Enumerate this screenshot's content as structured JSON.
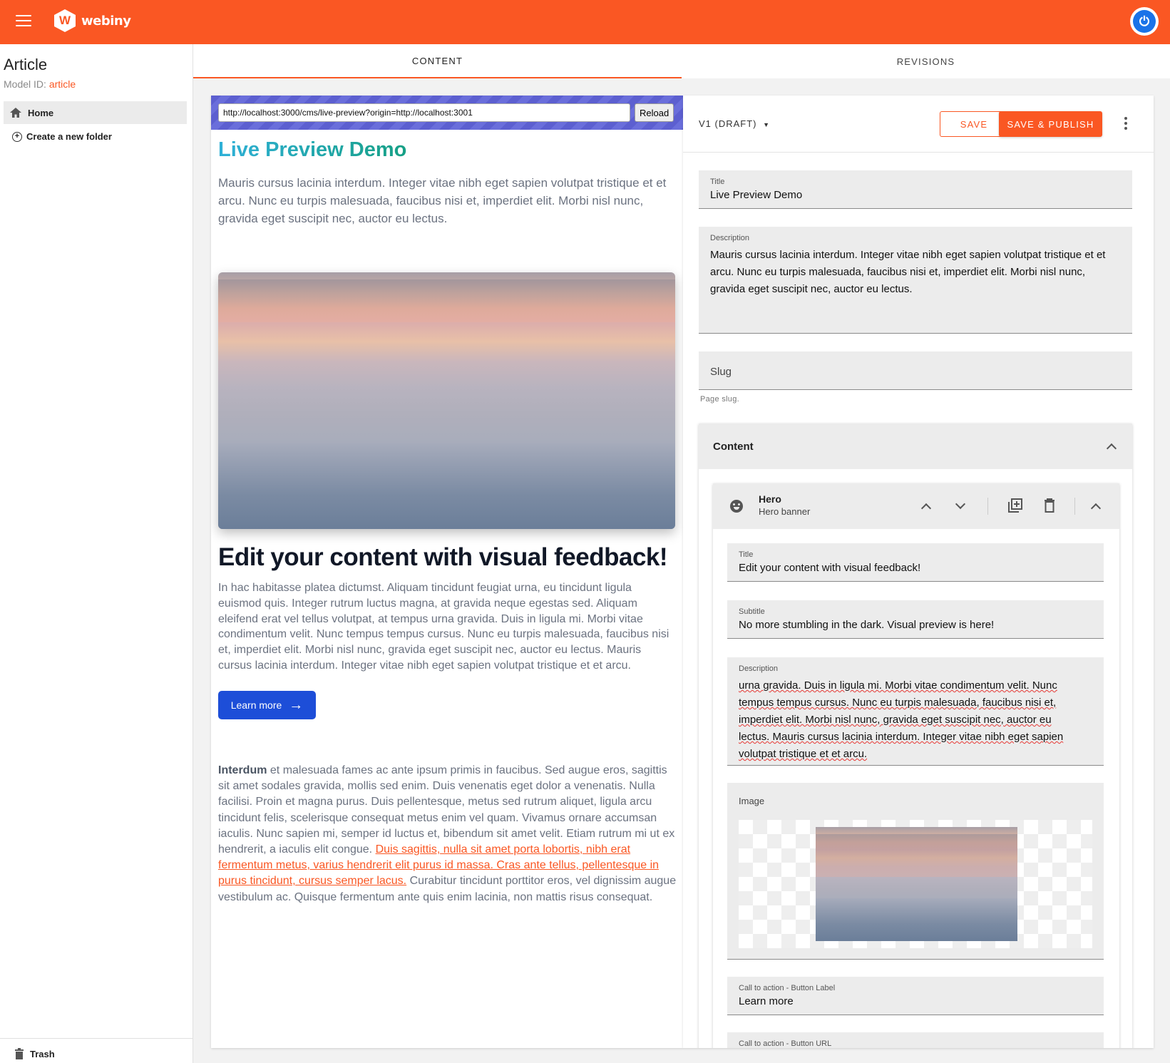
{
  "topbar": {
    "brand": "webiny",
    "logo_letter": "W",
    "accent": "#fa5723"
  },
  "sidebar": {
    "title": "Article",
    "model_label": "Model ID:",
    "model_id": "article",
    "home_label": "Home",
    "new_folder_label": "Create a new folder",
    "trash_label": "Trash"
  },
  "tabs": [
    {
      "label": "CONTENT",
      "active": true
    },
    {
      "label": "REVISIONS",
      "active": false
    }
  ],
  "preview": {
    "url": "http://localhost:3000/cms/live-preview?origin=http://localhost:3001",
    "reload_label": "Reload",
    "title": "Live Preview Demo",
    "description": "Mauris cursus lacinia interdum. Integer vitae nibh eget sapien volutpat tristique et et arcu. Nunc eu turpis malesuada, faucibus nisi et, imperdiet elit. Morbi nisl nunc, gravida eget suscipit nec, auctor eu lectus.",
    "hero_heading": "Edit your content with visual feedback!",
    "hero_paragraph": "In hac habitasse platea dictumst. Aliquam tincidunt feugiat urna, eu tincidunt ligula euismod quis. Integer rutrum luctus magna, at gravida neque egestas sed. Aliquam eleifend erat vel tellus volutpat, at tempus urna gravida. Duis in ligula mi. Morbi vitae condimentum velit. Nunc tempus tempus cursus. Nunc eu turpis malesuada, faucibus nisi et, imperdiet elit. Morbi nisl nunc, gravida eget suscipit nec, auctor eu lectus. Mauris cursus lacinia interdum. Integer vitae nibh eget sapien volutpat tristique et et arcu.",
    "cta_label": "Learn more",
    "body_bold": "Interdum",
    "body_text": " et malesuada fames ac ante ipsum primis in faucibus. Sed augue eros, sagittis sit amet sodales gravida, mollis sed enim. Duis venenatis eget dolor a venenatis. Nulla facilisi. Proin et magna purus. Duis pellentesque, metus sed rutrum aliquet, ligula arcu tincidunt felis, scelerisque consequat metus enim vel quam. Vivamus ornare accumsan iaculis. Nunc sapien mi, semper id luctus et, bibendum sit amet velit. Etiam rutrum mi ut ex hendrerit, a iaculis elit congue. ",
    "body_link": "Duis sagittis, nulla sit amet porta lobortis, nibh erat fermentum metus, varius hendrerit elit purus id massa. Cras ante tellus, pellentesque in purus tincidunt, cursus semper lacus.",
    "body_tail": " Curabitur tincidunt porttitor eros, vel dignissim augue vestibulum ac. Quisque fermentum ante quis enim lacinia, non mattis risus consequat."
  },
  "editor": {
    "version_label": "V1 (DRAFT)",
    "save_label": "SAVE",
    "publish_label": "SAVE & PUBLISH",
    "fields": {
      "title": {
        "label": "Title",
        "value": "Live Preview Demo"
      },
      "description": {
        "label": "Description",
        "value": "Mauris cursus lacinia interdum. Integer vitae nibh eget sapien volutpat tristique et et arcu. Nunc eu turpis malesuada, faucibus nisi et, imperdiet elit. Morbi nisl nunc, gravida eget suscipit nec, auctor eu lectus."
      },
      "slug": {
        "label": "Slug",
        "helper": "Page slug."
      }
    },
    "content_section": {
      "label": "Content",
      "hero": {
        "title": "Hero",
        "subtitle": "Hero banner",
        "fields": {
          "title": {
            "label": "Title",
            "value": "Edit your content with visual feedback!"
          },
          "subtitle": {
            "label": "Subtitle",
            "value": "No more stumbling in the dark. Visual preview is here!"
          },
          "description": {
            "label": "Description",
            "value": "urna gravida. Duis in ligula mi. Morbi vitae condimentum velit. Nunc tempus tempus cursus. Nunc eu turpis malesuada, faucibus nisi et, imperdiet elit. Morbi nisl nunc, gravida eget suscipit nec, auctor eu lectus. Mauris cursus lacinia interdum. Integer vitae nibh eget sapien volutpat tristique et et arcu."
          },
          "image": {
            "label": "Image"
          },
          "cta_label": {
            "label": "Call to action - Button Label",
            "value": "Learn more"
          },
          "cta_url": {
            "label": "Call to action - Button URL"
          }
        }
      }
    }
  }
}
